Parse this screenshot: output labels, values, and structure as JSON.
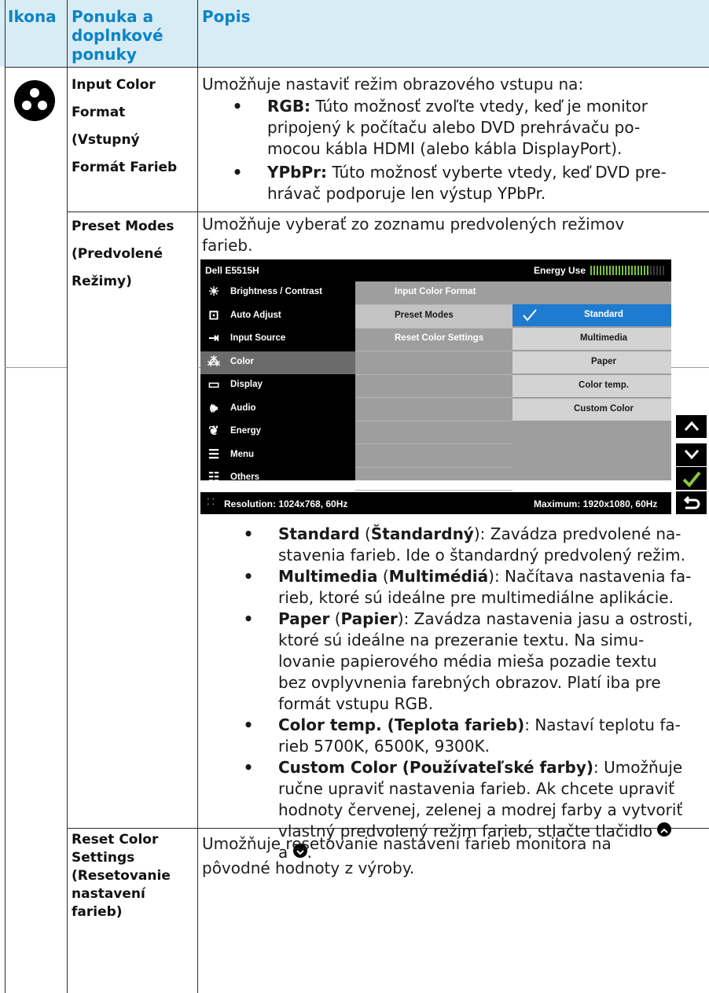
{
  "header": {
    "col_icon": "Ikona",
    "col_menu": "Ponuka a doplnkové ponuky",
    "col_desc": "Popis"
  },
  "rows": {
    "input_color_format": {
      "label_1": "Input Color",
      "label_2": "Format",
      "label_3": "(Vstupný",
      "label_4": "Formát Farieb",
      "intro": "Umožňuje nastaviť režim obrazového vstupu na:",
      "b1_term": "RGB:",
      "b1_l1": "Túto možnosť zvoľte vtedy, keď je monitor",
      "b1_l2": "pripojený k počítaču alebo DVD prehrávaču po-",
      "b1_l3": "mocou kábla HDMI (alebo kábla DisplayPort).",
      "b2_term": "YPbPr:",
      "b2_l1": "Túto možnosť vyberte vtedy, keď DVD pre-",
      "b2_l2": "hrávač podporuje len výstup YPbPr."
    },
    "preset_modes": {
      "label_1": "Preset Modes",
      "label_2": "(Predvolené",
      "label_3": "Režimy)",
      "intro_1": "Umožňuje vyberať zo zoznamu predvolených režimov",
      "intro_2": "farieb.",
      "s_term": "Standard",
      "s_term_sk": "Štandardný",
      "s_l1": ": Zavádza predvolené na-",
      "s_l2": "stavenia farieb. Ide o štandardný predvolený režim.",
      "m_term": "Multimedia",
      "m_term_sk": "Multimédiá",
      "m_l1": ": Načítava nastavenia fa-",
      "m_l2": "rieb, ktoré sú ideálne pre multimediálne aplikácie.",
      "p_term": "Paper",
      "p_term_sk": "Papier",
      "p_l1": ": Zavádza nastavenia jasu a ostrosti,",
      "p_l2": "ktoré sú ideálne na prezeranie textu. Na simu-",
      "p_l3": "lovanie papierového média mieša pozadie textu",
      "p_l4": "bez ovplyvnenia farebných obrazov. Platí iba pre",
      "p_l5": "formát vstupu RGB.",
      "c_term": "Color temp. (Teplota farieb)",
      "c_l1": ": Nastaví teplotu fa-",
      "c_l2": "rieb 5700K, 6500K, 9300K.",
      "cc_term": "Custom Color (Používateľské farby)",
      "cc_l1": ": Umožňuje",
      "cc_l2": "ručne upraviť nastavenia farieb. Ak chcete upraviť",
      "cc_l3": "hodnoty červenej, zelenej a modrej farby a vytvoriť",
      "cc_l4": "vlastný predvolený režim farieb, stlačte tlačidlo",
      "cc_l5a": "a",
      "cc_l5b": "."
    },
    "reset_color": {
      "label_1": "Reset Color",
      "label_2": "Settings",
      "label_3": "(Resetovanie",
      "label_4": "nastavení",
      "label_5": "farieb)",
      "desc_1": "Umožňuje resetovanie nastavení farieb monitora na",
      "desc_2": "pôvodné hodnoty z výroby."
    }
  },
  "osd": {
    "model": "Dell E5515H",
    "energy_label": "Energy Use",
    "energy_level": 0.78,
    "menu": [
      {
        "label": "Brightness / Contrast",
        "icon": "sun-icon"
      },
      {
        "label": "Auto Adjust",
        "icon": "auto-adjust-icon"
      },
      {
        "label": "Input Source",
        "icon": "input-source-icon"
      },
      {
        "label": "Color",
        "icon": "color-dots-icon"
      },
      {
        "label": "Display",
        "icon": "display-icon"
      },
      {
        "label": "Audio",
        "icon": "speaker-icon"
      },
      {
        "label": "Energy",
        "icon": "leaf-icon"
      },
      {
        "label": "Menu",
        "icon": "menu-icon"
      },
      {
        "label": "Others",
        "icon": "sliders-icon"
      }
    ],
    "submenu": [
      "Input Color Format",
      "Preset Modes",
      "Reset Color Settings"
    ],
    "options": [
      "Standard",
      "Multimedia",
      "Paper",
      "Color temp.",
      "Custom Color"
    ],
    "resolution": "Resolution: 1024x768, 60Hz",
    "maximum": "Maximum: 1920x1080, 60Hz"
  }
}
